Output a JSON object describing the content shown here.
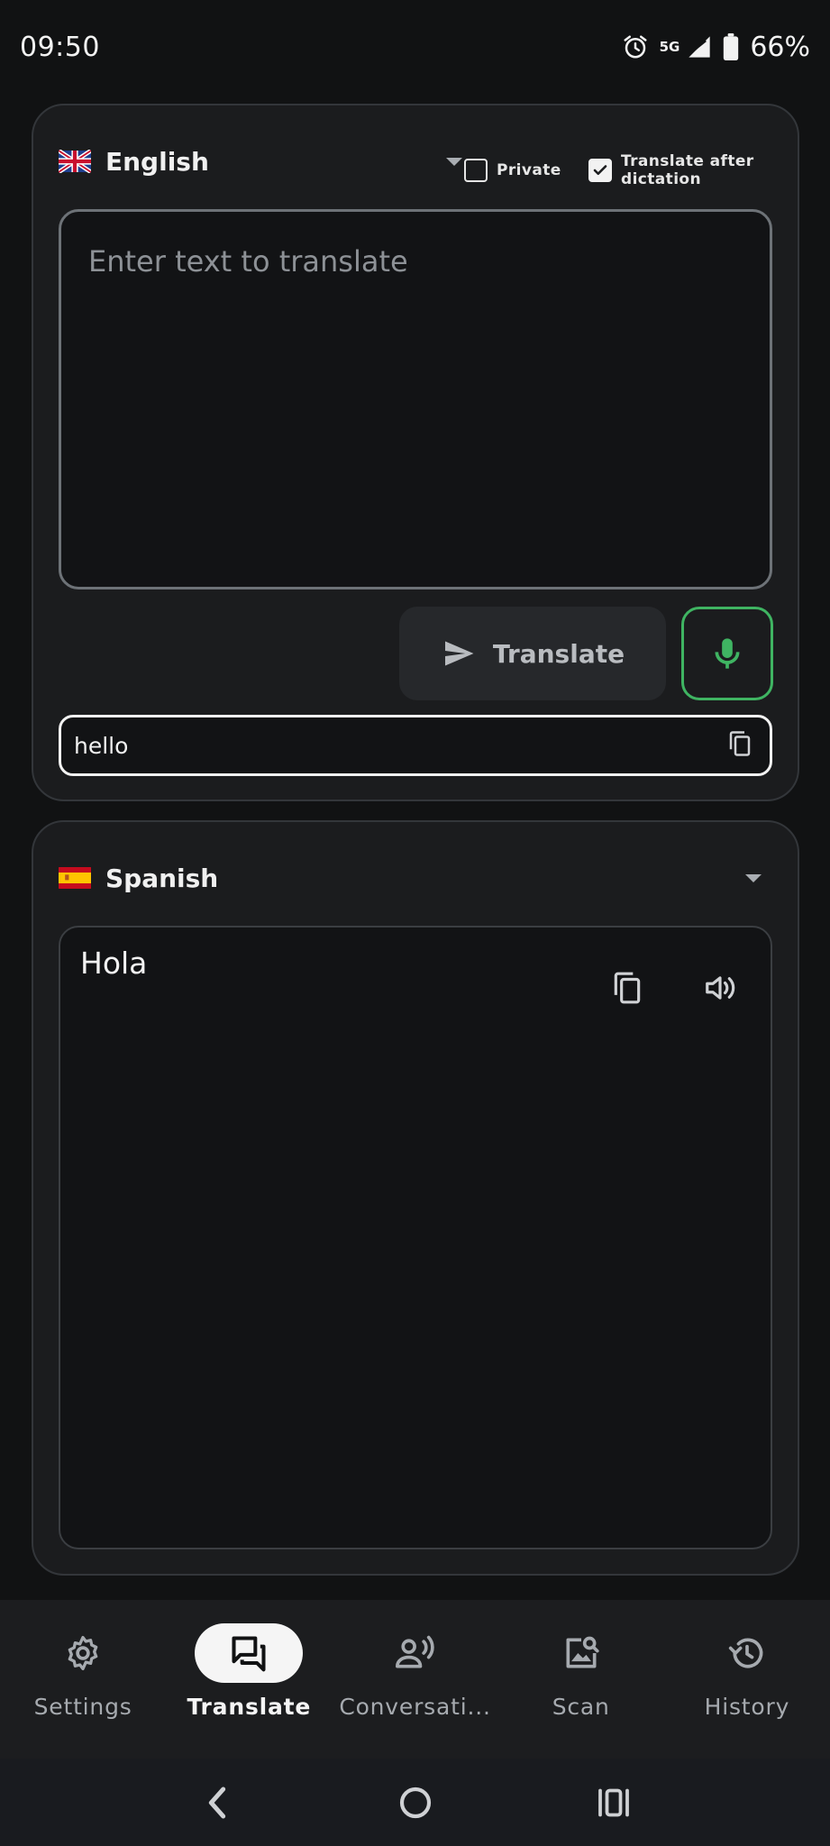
{
  "status_bar": {
    "time": "09:50",
    "network": "5G",
    "battery": "66%"
  },
  "source": {
    "language": "English",
    "private_label": "Private",
    "private_checked": false,
    "translate_after_dictation_label_1": "Translate after",
    "translate_after_dictation_label_2": "dictation",
    "translate_after_dictation_checked": true,
    "input_placeholder": "Enter text to translate",
    "translate_button": "Translate",
    "history_text": "hello"
  },
  "target": {
    "language": "Spanish",
    "output_text": "Hola"
  },
  "bottom_nav": {
    "items": [
      {
        "label": "Settings",
        "icon": "gear-icon",
        "active": false
      },
      {
        "label": "Translate",
        "icon": "chat-icon",
        "active": true
      },
      {
        "label": "Conversati...",
        "icon": "voice-person-icon",
        "active": false
      },
      {
        "label": "Scan",
        "icon": "image-search-icon",
        "active": false
      },
      {
        "label": "History",
        "icon": "history-icon",
        "active": false
      }
    ]
  },
  "colors": {
    "background": "#111213",
    "card": "#1b1c1e",
    "accent_green": "#3fb462"
  }
}
